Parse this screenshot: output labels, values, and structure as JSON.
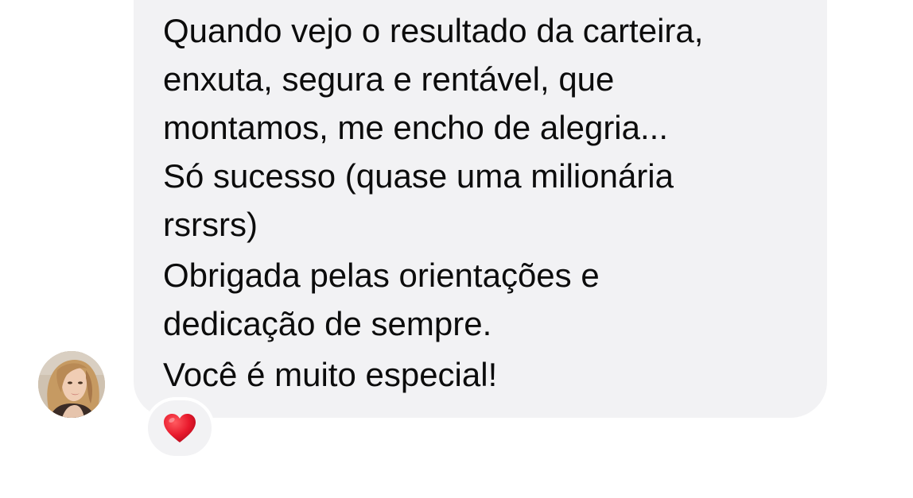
{
  "message": {
    "paragraphs": [
      {
        "lines": [
          "Quando vejo o resultado da carteira,",
          "enxuta, segura e rentável, que",
          "montamos, me encho de alegria...",
          "Só sucesso (quase uma milionária",
          "rsrsrs)"
        ]
      },
      {
        "lines": [
          "Obrigada pelas orientações e",
          "dedicação de sempre."
        ]
      },
      {
        "lines": [
          "Você é muito especial!"
        ]
      }
    ]
  },
  "reaction": {
    "emoji": "❤️",
    "icon": "red-heart-icon"
  },
  "avatar": {
    "icon": "sender-avatar"
  },
  "colors": {
    "bubble": "#f2f2f4",
    "text": "#0c0c0c",
    "heart": "#e8192c"
  }
}
